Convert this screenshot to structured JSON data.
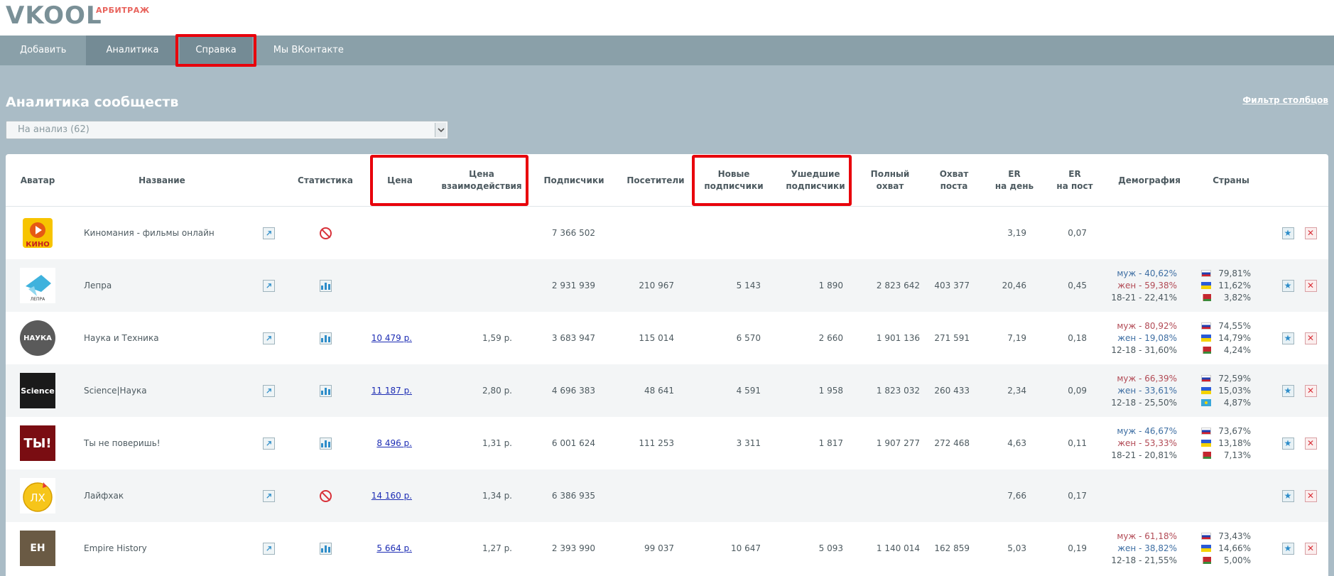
{
  "brand": {
    "logo": "VKOOL",
    "sublabel": "АРБИТРАЖ"
  },
  "nav": [
    {
      "label": "Добавить"
    },
    {
      "label": "Аналитика"
    },
    {
      "label": "Справка"
    },
    {
      "label": "Мы ВКонтакте"
    }
  ],
  "page": {
    "title": "Аналитика сообществ",
    "filter_link": "Фильтр столбцов",
    "select_value": "На анализ (62)"
  },
  "colors": {
    "accent": "#8aa0a9",
    "highlight": "#e8000b",
    "male": "#3f6fa3",
    "female": "#b24b56"
  },
  "headers": {
    "avatar": "Аватар",
    "name": "Название",
    "stats": "Статистика",
    "price": "Цена",
    "price_interaction_1": "Цена",
    "price_interaction_2": "взаимодействия",
    "subscribers": "Подписчики",
    "visitors": "Посетители",
    "new_subs_1": "Новые",
    "new_subs_2": "подписчики",
    "left_subs_1": "Ушедшие",
    "left_subs_2": "подписчики",
    "full_reach_1": "Полный",
    "full_reach_2": "охват",
    "post_reach_1": "Охват",
    "post_reach_2": "поста",
    "er_day_1": "ER",
    "er_day_2": "на день",
    "er_post_1": "ER",
    "er_post_2": "на пост",
    "demography": "Демография",
    "countries": "Страны"
  },
  "rows": [
    {
      "name": "Киномания - фильмы онлайн",
      "avatar": "КИНО",
      "stats": "ban",
      "price": "",
      "price_interaction": "",
      "subscribers": "7 366 502",
      "visitors": "",
      "new_subs": "",
      "left_subs": "",
      "full_reach": "",
      "post_reach": "",
      "er_day": "3,19",
      "er_post": "0,07",
      "demo": [],
      "countries": []
    },
    {
      "name": "Лепра",
      "avatar": "ЛЕПРА",
      "stats": "chart",
      "price": "",
      "price_interaction": "",
      "subscribers": "2 931 939",
      "visitors": "210 967",
      "new_subs": "5 143",
      "left_subs": "1 890",
      "full_reach": "2 823 642",
      "post_reach": "403 377",
      "er_day": "20,46",
      "er_post": "0,45",
      "demo": [
        {
          "t": "муж - 40,62%",
          "k": "m"
        },
        {
          "t": "жен - 59,38%",
          "k": "f"
        },
        {
          "t": "18-21 - 22,41%",
          "k": "a"
        }
      ],
      "countries": [
        {
          "flag": "ru",
          "v": "79,81%"
        },
        {
          "flag": "ua",
          "v": "11,62%"
        },
        {
          "flag": "by",
          "v": "3,82%"
        }
      ]
    },
    {
      "name": "Наука и Техника",
      "avatar": "НАУКА",
      "stats": "chart",
      "price": "10 479 р.",
      "price_interaction": "1,59 р.",
      "subscribers": "3 683 947",
      "visitors": "115 014",
      "new_subs": "6 570",
      "left_subs": "2 660",
      "full_reach": "1 901 136",
      "post_reach": "271 591",
      "er_day": "7,19",
      "er_post": "0,18",
      "demo": [
        {
          "t": "муж - 80,92%",
          "k": "f"
        },
        {
          "t": "жен - 19,08%",
          "k": "m"
        },
        {
          "t": "12-18 - 31,60%",
          "k": "a"
        }
      ],
      "countries": [
        {
          "flag": "ru",
          "v": "74,55%"
        },
        {
          "flag": "ua",
          "v": "14,79%"
        },
        {
          "flag": "by",
          "v": "4,24%"
        }
      ]
    },
    {
      "name": "Science|Наука",
      "avatar": "Science",
      "stats": "chart",
      "price": "11 187 р.",
      "price_interaction": "2,80 р.",
      "subscribers": "4 696 383",
      "visitors": "48 641",
      "new_subs": "4 591",
      "left_subs": "1 958",
      "full_reach": "1 823 032",
      "post_reach": "260 433",
      "er_day": "2,34",
      "er_post": "0,09",
      "demo": [
        {
          "t": "муж - 66,39%",
          "k": "f"
        },
        {
          "t": "жен - 33,61%",
          "k": "m"
        },
        {
          "t": "12-18 - 25,50%",
          "k": "a"
        }
      ],
      "countries": [
        {
          "flag": "ru",
          "v": "72,59%"
        },
        {
          "flag": "ua",
          "v": "15,03%"
        },
        {
          "flag": "kz",
          "v": "4,87%"
        }
      ]
    },
    {
      "name": "Ты не поверишь!",
      "avatar": "ТЫ!",
      "stats": "chart",
      "price": "8 496 р.",
      "price_interaction": "1,31 р.",
      "subscribers": "6 001 624",
      "visitors": "111 253",
      "new_subs": "3 311",
      "left_subs": "1 817",
      "full_reach": "1 907 277",
      "post_reach": "272 468",
      "er_day": "4,63",
      "er_post": "0,11",
      "demo": [
        {
          "t": "муж - 46,67%",
          "k": "m"
        },
        {
          "t": "жен - 53,33%",
          "k": "f"
        },
        {
          "t": "18-21 - 20,81%",
          "k": "a"
        }
      ],
      "countries": [
        {
          "flag": "ru",
          "v": "73,67%"
        },
        {
          "flag": "ua",
          "v": "13,18%"
        },
        {
          "flag": "by",
          "v": "7,13%"
        }
      ]
    },
    {
      "name": "Лайфхак",
      "avatar": "ЛХ",
      "stats": "ban",
      "price": "14 160 р.",
      "price_interaction": "1,34 р.",
      "subscribers": "6 386 935",
      "visitors": "",
      "new_subs": "",
      "left_subs": "",
      "full_reach": "",
      "post_reach": "",
      "er_day": "7,66",
      "er_post": "0,17",
      "demo": [],
      "countries": []
    },
    {
      "name": "Empire History",
      "avatar": "EH",
      "stats": "chart",
      "price": "5 664 р.",
      "price_interaction": "1,27 р.",
      "subscribers": "2 393 990",
      "visitors": "99 037",
      "new_subs": "10 647",
      "left_subs": "5 093",
      "full_reach": "1 140 014",
      "post_reach": "162 859",
      "er_day": "5,03",
      "er_post": "0,19",
      "demo": [
        {
          "t": "муж - 61,18%",
          "k": "f"
        },
        {
          "t": "жен - 38,82%",
          "k": "m"
        },
        {
          "t": "12-18 - 21,55%",
          "k": "a"
        }
      ],
      "countries": [
        {
          "flag": "ru",
          "v": "73,43%"
        },
        {
          "flag": "ua",
          "v": "14,66%"
        },
        {
          "flag": "by",
          "v": "5,00%"
        }
      ]
    }
  ]
}
